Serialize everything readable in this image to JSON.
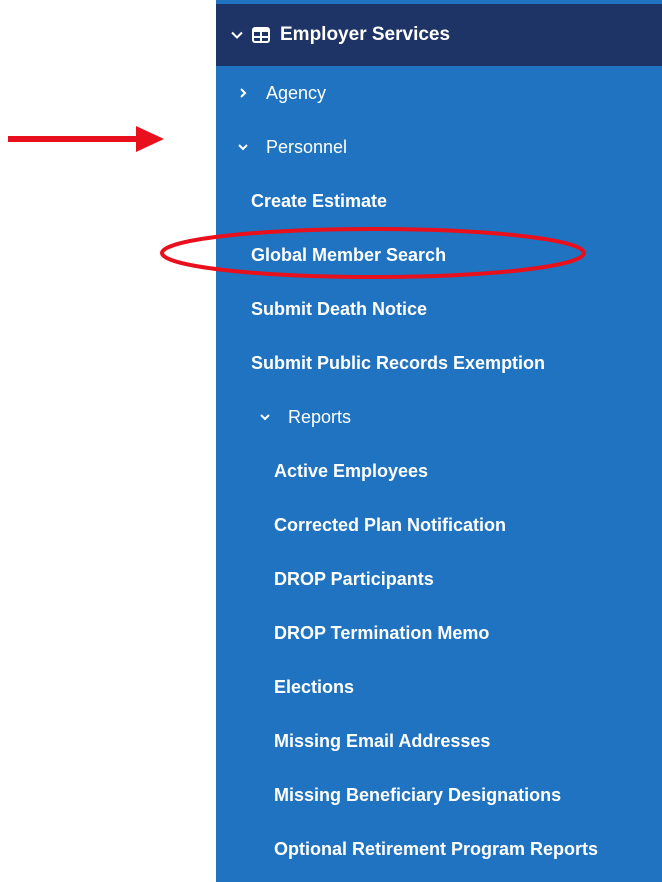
{
  "menu": {
    "section_label": "Employer Services",
    "items": [
      {
        "label": "Agency"
      },
      {
        "label": "Personnel"
      },
      {
        "label": "Create Estimate"
      },
      {
        "label": "Global Member Search"
      },
      {
        "label": "Submit Death Notice"
      },
      {
        "label": "Submit Public Records Exemption"
      },
      {
        "label": "Reports"
      }
    ],
    "reports": [
      {
        "label": "Active Employees"
      },
      {
        "label": "Corrected Plan Notification"
      },
      {
        "label": "DROP Participants"
      },
      {
        "label": "DROP Termination Memo"
      },
      {
        "label": "Elections"
      },
      {
        "label": "Missing Email Addresses"
      },
      {
        "label": "Missing Beneficiary Designations"
      },
      {
        "label": "Optional Retirement Program Reports"
      }
    ]
  },
  "colors": {
    "sidebar_bg": "#1f73c0",
    "header_bg": "#1f3466",
    "annotation": "#e8101c"
  }
}
